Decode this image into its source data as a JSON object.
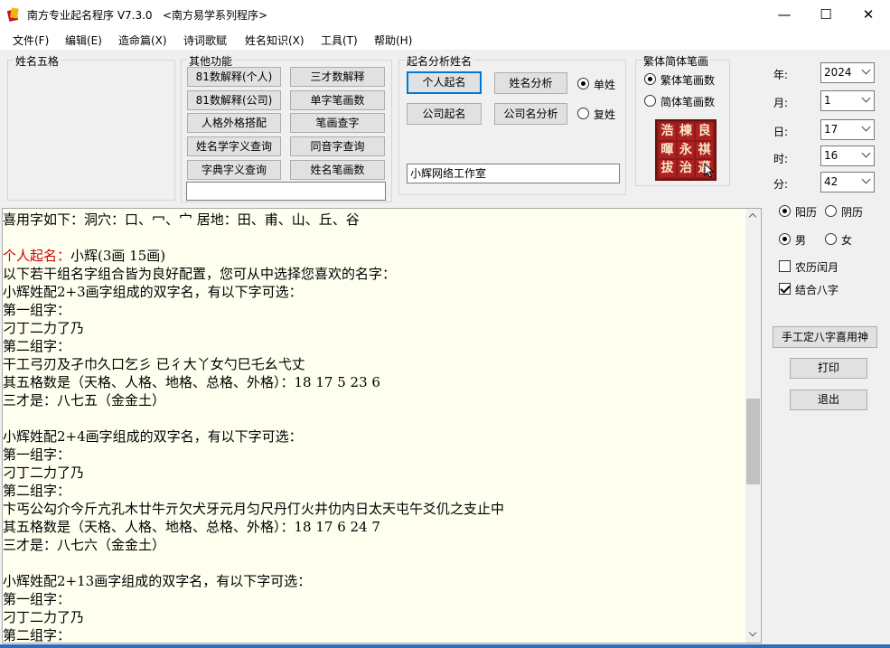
{
  "window": {
    "title": "南方专业起名程序 V7.3.0   <南方易学系列程序>",
    "minimize": "—",
    "maximize": "☐",
    "close": "✕"
  },
  "menu": [
    "文件(F)",
    "编辑(E)",
    "造命篇(X)",
    "诗词歌赋",
    "姓名知识(X)",
    "工具(T)",
    "帮助(H)"
  ],
  "groups": {
    "wuge": "姓名五格",
    "other": "其他功能",
    "analysis": "起名分析姓名",
    "fanjian": "繁体简体笔画"
  },
  "other_buttons": [
    "81数解释(个人)",
    "三才数解释",
    "81数解释(公司)",
    "单字笔画数",
    "人格外格搭配",
    "笔画查字",
    "姓名学字义查询",
    "同音字查询",
    "字典字义查询",
    "姓名笔画数"
  ],
  "other_input": "",
  "analysis_buttons": {
    "personal": "个人起名",
    "name_analysis": "姓名分析",
    "company": "公司起名",
    "company_analysis": "公司名分析"
  },
  "surname_type": {
    "single": "单姓",
    "double": "复姓",
    "selected": "single"
  },
  "studio_input": "小辉网络工作室",
  "stroke_mode": {
    "traditional": "繁体笔画数",
    "simplified": "简体笔画数",
    "selected": "traditional"
  },
  "trad_chars": [
    "浩",
    "棟",
    "良",
    "暉",
    "永",
    "祺",
    "拔",
    "治",
    "邁"
  ],
  "date": {
    "year_label": "年:",
    "year": "2024",
    "month_label": "月:",
    "month": "1",
    "day_label": "日:",
    "day": "17",
    "hour_label": "时:",
    "hour": "16",
    "minute_label": "分:",
    "minute": "42"
  },
  "calendar": {
    "solar": "阳历",
    "lunar": "阴历",
    "selected": "solar"
  },
  "gender": {
    "male": "男",
    "female": "女",
    "selected": "male"
  },
  "checks": {
    "leap": "农历闰月",
    "leap_checked": false,
    "bazi": "结合八字",
    "bazi_checked": true
  },
  "right_buttons": {
    "set_bazi": "手工定八字喜用神",
    "print": "打印",
    "exit": "退出"
  },
  "text_lines": [
    "喜用字如下：洞穴：口、冖、宀 居地：田、甫、山、丘、谷",
    "",
    "个人起名：",
    "以下若干组名字组合皆为良好配置，您可从中选择您喜欢的名字：",
    "小辉姓配2+3画字组成的双字名，有以下字可选：",
    "第一组字：",
    "刁丁二力了乃",
    "第二组字：",
    "干工弓刃及孑巾久口乞彡 已彳大丫女勺巳乇幺弋丈",
    "其五格数是（天格、人格、地格、总格、外格）：18 17 5 23 6",
    "三才是：八七五（金金土）",
    "",
    "小辉姓配2+4画字组成的双字名，有以下字可选：",
    "第一组字：",
    "刁丁二力了乃",
    "第二组字：",
    "卞丐公勾介今斤亢孔木廿牛亓欠犬牙元月匀尺丹仃火井仂内日太天屯午爻仉之支止中",
    "其五格数是（天格、人格、地格、总格、外格）：18 17 6 24 7",
    "三才是：八七六（金金土）",
    "",
    "小辉姓配2+13画字组成的双字名，有以下字可选：",
    "第一组字：",
    "刁丁二力了乃",
    "第二组字："
  ],
  "personal_name_suffix": "小辉(3画 15画)"
}
